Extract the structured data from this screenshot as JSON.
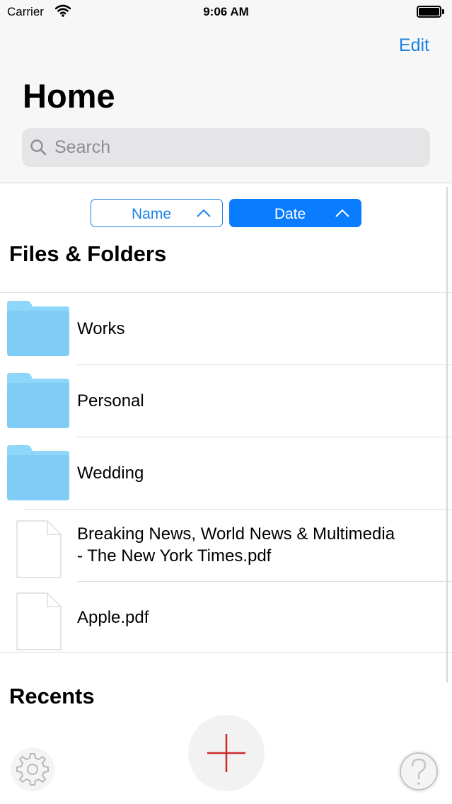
{
  "status_bar": {
    "carrier": "Carrier",
    "time": "9:06 AM"
  },
  "nav": {
    "edit_label": "Edit",
    "title": "Home"
  },
  "search": {
    "placeholder": "Search"
  },
  "sort": {
    "name_label": "Name",
    "date_label": "Date",
    "active": "Date"
  },
  "sections": {
    "files_title": "Files & Folders",
    "recents_title": "Recents"
  },
  "items": [
    {
      "type": "folder",
      "name": "Works"
    },
    {
      "type": "folder",
      "name": "Personal"
    },
    {
      "type": "folder",
      "name": "Wedding"
    },
    {
      "type": "file",
      "name_line1": "Breaking News, World News & Multimedia",
      "name_line2": "- The New York Times.pdf"
    },
    {
      "type": "file",
      "name": "Apple.pdf"
    }
  ],
  "toolbar": {
    "add": "plus-icon",
    "settings": "gear-icon",
    "help": "question-mark-icon"
  },
  "colors": {
    "accent": "#1a82e5",
    "active_sort": "#0a7cff",
    "folder": "#7fcdf7",
    "add_plus": "#cc2a2a"
  }
}
